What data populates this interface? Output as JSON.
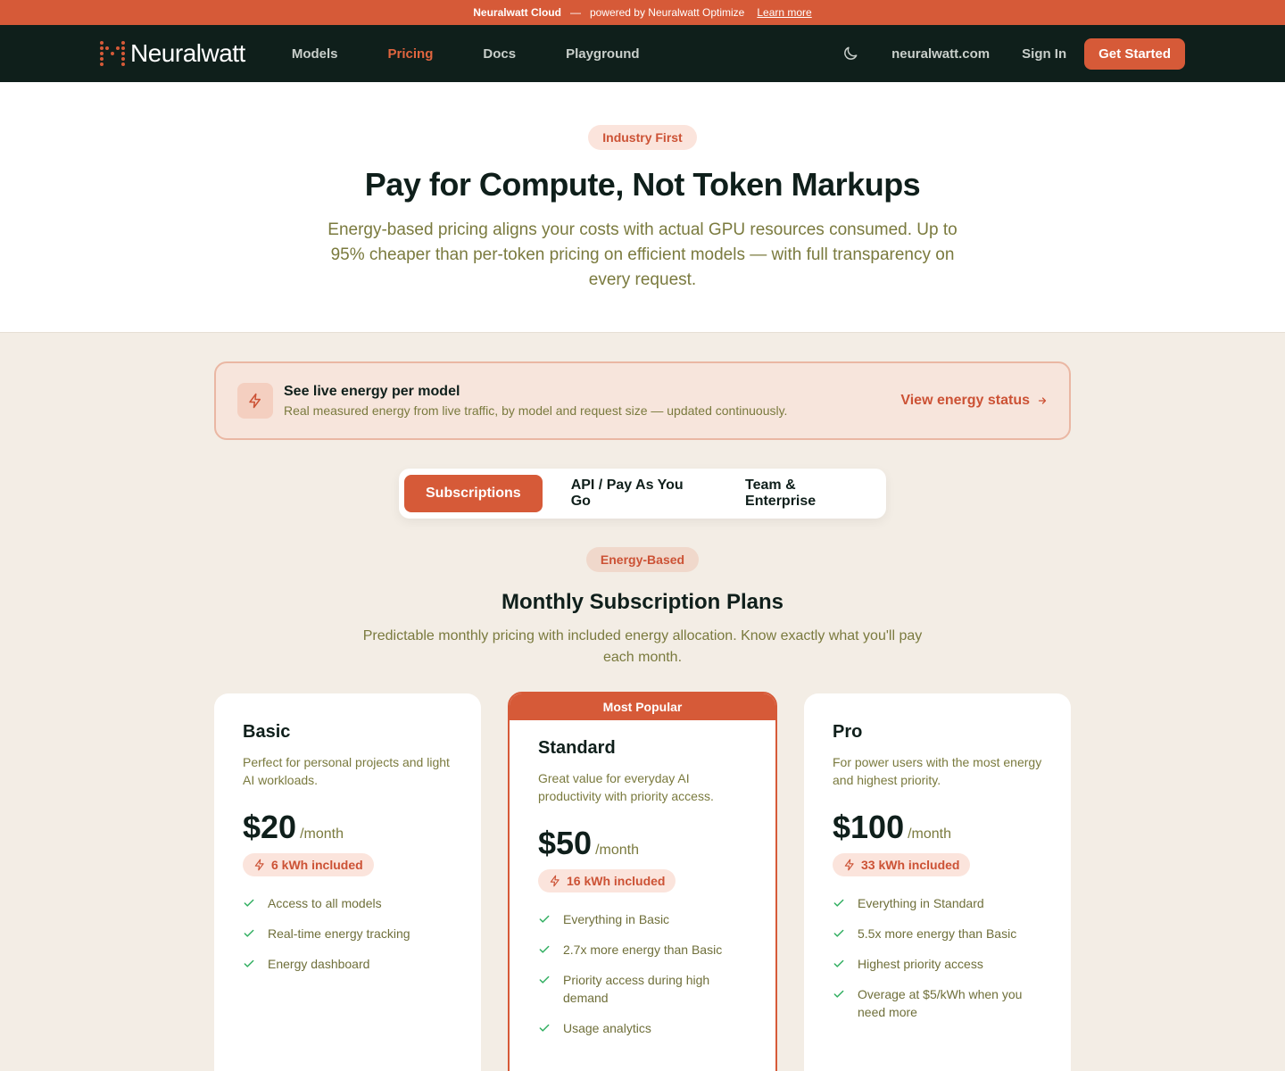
{
  "announcement": {
    "brand": "Neuralwatt Cloud",
    "separator": "—",
    "powered": "powered by Neuralwatt Optimize",
    "link": "Learn more"
  },
  "nav": {
    "logo": "Neuralwatt",
    "links": [
      "Models",
      "Pricing",
      "Docs",
      "Playground"
    ],
    "active": "Pricing",
    "site": "neuralwatt.com",
    "sign_in": "Sign In",
    "cta": "Get Started"
  },
  "hero": {
    "badge": "Industry First",
    "title": "Pay for Compute, Not Token Markups",
    "subtitle": "Energy-based pricing aligns your costs with actual GPU resources consumed. Up to 95% cheaper than per-token pricing on efficient models — with full transparency on every request."
  },
  "banner": {
    "icon": "bolt-icon",
    "title": "See live energy per model",
    "subtitle": "Real measured energy from live traffic, by model and request size — updated continuously.",
    "link": "View energy status"
  },
  "tabs": [
    "Subscriptions",
    "API / Pay As You Go",
    "Team & Enterprise"
  ],
  "section": {
    "badge": "Energy-Based",
    "title": "Monthly Subscription Plans",
    "subtitle": "Predictable monthly pricing with included energy allocation. Know exactly what you'll pay each month."
  },
  "plans": [
    {
      "name": "Basic",
      "description": "Perfect for personal projects and light AI workloads.",
      "price": "$20",
      "period": "/month",
      "energy": "6 kWh included",
      "features": [
        "Access to all models",
        "Real-time energy tracking",
        "Energy dashboard"
      ]
    },
    {
      "name": "Standard",
      "ribbon": "Most Popular",
      "description": "Great value for everyday AI productivity with priority access.",
      "price": "$50",
      "period": "/month",
      "energy": "16 kWh included",
      "features": [
        "Everything in Basic",
        "2.7x more energy than Basic",
        "Priority access during high demand",
        "Usage analytics"
      ]
    },
    {
      "name": "Pro",
      "description": "For power users with the most energy and highest priority.",
      "price": "$100",
      "period": "/month",
      "energy": "33 kWh included",
      "features": [
        "Everything in Standard",
        "5.5x more energy than Basic",
        "Highest priority access",
        "Overage at $5/kWh when you need more"
      ]
    }
  ],
  "colors": {
    "accent": "#d65a38",
    "nav_bg": "#0f1f1b",
    "page_bg": "#f3ede5",
    "muted_text": "#7a7a3e",
    "check": "#2fae5f"
  }
}
